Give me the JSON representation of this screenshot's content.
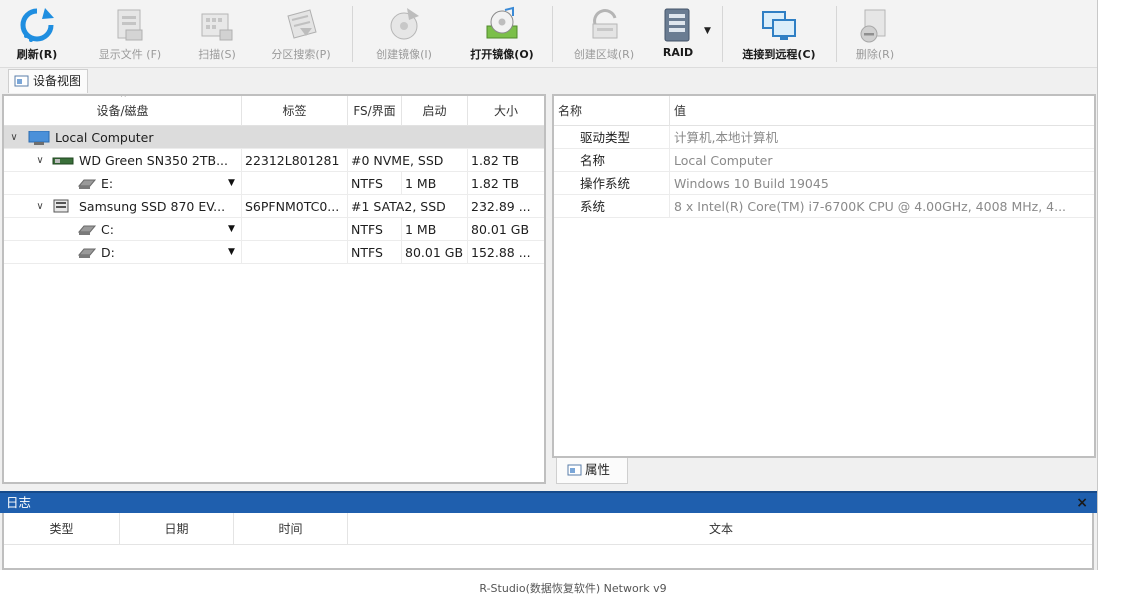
{
  "toolbar": {
    "buttons": [
      {
        "label": "刷新(R)",
        "icon": "refresh-icon",
        "active": true
      },
      {
        "label": "显示文件 (F)",
        "icon": "show-files-icon",
        "active": false
      },
      {
        "label": "扫描(S)",
        "icon": "scan-icon",
        "active": false
      },
      {
        "label": "分区搜索(P)",
        "icon": "partition-search-icon",
        "active": false
      },
      {
        "label": "创建镜像(I)",
        "icon": "create-image-icon",
        "active": false
      },
      {
        "label": "打开镜像(O)",
        "icon": "open-image-icon",
        "active": true
      },
      {
        "label": "创建区域(R)",
        "icon": "create-region-icon",
        "active": false
      },
      {
        "label": "RAID",
        "icon": "raid-icon",
        "active": true
      },
      {
        "label": "连接到远程(C)",
        "icon": "connect-remote-icon",
        "active": true
      },
      {
        "label": "删除(R)",
        "icon": "delete-icon",
        "active": false
      }
    ]
  },
  "device_view": {
    "tab_label": "设备视图",
    "columns": [
      "设备/磁盘",
      "标签",
      "FS/界面",
      "启动",
      "大小"
    ],
    "rows": [
      {
        "name": "Local Computer",
        "label": "",
        "fs": "",
        "start": "",
        "size": ""
      },
      {
        "name": "WD Green SN350 2TB...",
        "label": "22312L801281",
        "fs": "#0 NVME, SSD",
        "start": "",
        "size": "1.82 TB"
      },
      {
        "name": "E:",
        "label": "",
        "fs": "NTFS",
        "start": "1 MB",
        "size": "1.82 TB"
      },
      {
        "name": "Samsung SSD 870 EV...",
        "label": "S6PFNM0TC0...",
        "fs": "#1 SATA2, SSD",
        "start": "",
        "size": "232.89 ..."
      },
      {
        "name": "C:",
        "label": "",
        "fs": "NTFS",
        "start": "1 MB",
        "size": "80.01 GB"
      },
      {
        "name": "D:",
        "label": "",
        "fs": "NTFS",
        "start": "80.01 GB",
        "size": "152.88 ..."
      }
    ]
  },
  "properties": {
    "columns": [
      "名称",
      "值"
    ],
    "rows": [
      {
        "key": "驱动类型",
        "value": "计算机,本地计算机"
      },
      {
        "key": "名称",
        "value": "Local Computer"
      },
      {
        "key": "操作系统",
        "value": "Windows 10 Build 19045"
      },
      {
        "key": "系统",
        "value": "8 x Intel(R) Core(TM) i7-6700K CPU @ 4.00GHz, 4008 MHz, 4..."
      }
    ],
    "tab_label": "属性"
  },
  "log": {
    "title": "日志",
    "close": "×",
    "columns": [
      "类型",
      "日期",
      "时间",
      "文本"
    ]
  },
  "caption": "R-Studio(数据恢复软件) Network v9",
  "colors": {
    "accent": "#1f5fae",
    "selected_row": "#dcdcdc"
  }
}
